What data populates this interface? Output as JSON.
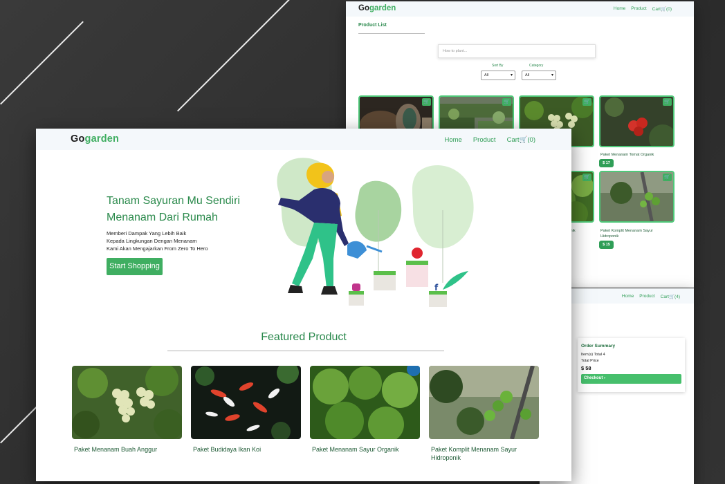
{
  "brand": {
    "prefix": "Go",
    "accent": "garden",
    "color": "#3fae61"
  },
  "colors": {
    "primary": "#3fae61",
    "link": "#2e9d55",
    "dark_green": "#27874a"
  },
  "product_list_window": {
    "nav": {
      "home": "Home",
      "product": "Product",
      "cart_label": "Cart",
      "cart_count": "(0)"
    },
    "page_title": "Product List",
    "search": {
      "placeholder": "How to plant..."
    },
    "sort_by": {
      "label": "Sort By",
      "value": "All"
    },
    "category": {
      "label": "Category",
      "value": "All"
    },
    "products": [
      {
        "name": "",
        "price": "",
        "image": "soil-seedling"
      },
      {
        "name": "",
        "price": "",
        "image": "garden-beds"
      },
      {
        "name": "",
        "price": "",
        "image": "grapes"
      },
      {
        "name": "Paket Menanam Tomat Organik",
        "price": "$ 17",
        "image": "tomatoes"
      },
      {
        "name": "...onik",
        "price": "",
        "image": "kale"
      },
      {
        "name": "Paket Komplit Menanam Sayur Hidroponik",
        "price": "$ 15",
        "image": "hydroponic-tomato"
      }
    ]
  },
  "cart_window": {
    "nav": {
      "home": "Home",
      "product": "Product",
      "cart_label": "Cart",
      "cart_count": "(4)"
    },
    "order_summary": {
      "title": "Order Summary",
      "items_total": "Item(s) Total 4",
      "total_price_label": "Total Price",
      "total_price": "$ 58",
      "checkout_label": "Checkout ›"
    }
  },
  "landing_window": {
    "nav": {
      "home": "Home",
      "product": "Product",
      "cart_label": "Cart",
      "cart_count": "(0)"
    },
    "hero": {
      "title_line1": "Tanam Sayuran Mu Sendiri",
      "title_line2": "Menanam Dari Rumah",
      "desc_line1": "Memberi Dampak Yang Lebih Baik",
      "desc_line2": "Kepada Lingkungan Dengan Menanam",
      "desc_line3": "Kami Akan Mengajarkan From Zero To Hero",
      "button_label": "Start Shopping"
    },
    "featured": {
      "title": "Featured Product",
      "products": [
        {
          "name": "Paket Menanam Buah Anggur",
          "image": "grapes"
        },
        {
          "name": "Paket Budidaya Ikan Koi",
          "image": "koi-fish"
        },
        {
          "name": "Paket Menanam Sayur Organik",
          "image": "kale"
        },
        {
          "name": "Paket Komplit Menanam Sayur Hidroponik",
          "image": "hydroponic-tomato"
        }
      ]
    }
  }
}
